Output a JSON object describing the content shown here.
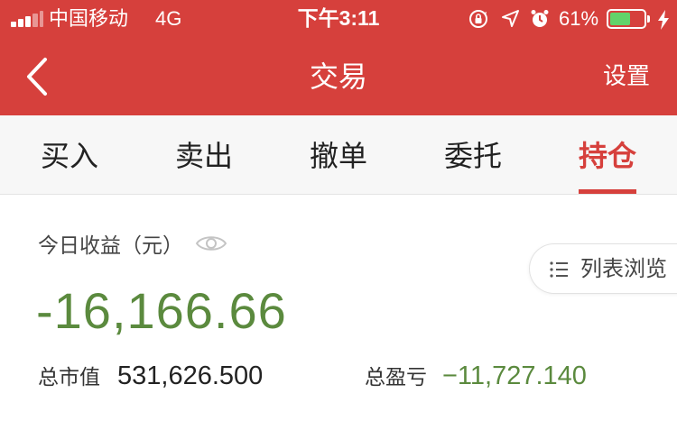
{
  "status_bar": {
    "carrier": "中国移动",
    "network": "4G",
    "time": "下午3:11",
    "battery_percent_label": "61%",
    "battery_level": 0.61,
    "signal_bars_filled": 3,
    "signal_bars_total": 5,
    "icons": [
      "orientation-lock-icon",
      "location-arrow-icon",
      "alarm-icon",
      "battery-icon",
      "charging-bolt-icon"
    ]
  },
  "nav": {
    "back_icon": "chevron-left-icon",
    "title": "交易",
    "settings_label": "设置"
  },
  "tabs": [
    {
      "label": "买入",
      "active": false
    },
    {
      "label": "卖出",
      "active": false
    },
    {
      "label": "撤单",
      "active": false
    },
    {
      "label": "委托",
      "active": false
    },
    {
      "label": "持仓",
      "active": true
    }
  ],
  "summary": {
    "today_pl_label": "今日收益（元）",
    "today_pl_value": "-16,166.66",
    "eye_icon": "eye-icon",
    "list_view_label": "列表浏览",
    "list_view_icon": "list-icon",
    "market_value_label": "总市值",
    "market_value": "531,626.500",
    "total_pl_label": "总盈亏",
    "total_pl_value": "−11,727.140"
  },
  "colors": {
    "brand_red": "#d6403c",
    "loss_green": "#5b8a3e",
    "battery_green": "#62d36a"
  }
}
